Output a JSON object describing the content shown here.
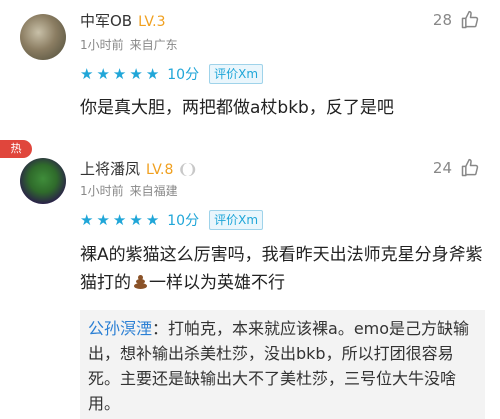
{
  "comments": [
    {
      "username": "中军OB",
      "level": "LV.3",
      "time": "1小时前",
      "location": "来自广东",
      "likes": "28",
      "stars": 5,
      "score": "10分",
      "eval_tag": "评价Xm",
      "text": "你是真大胆，两把都做a杖bkb，反了是吧"
    },
    {
      "hot_badge": "热",
      "username": "上将潘凤",
      "level": "LV.8",
      "time": "1小时前",
      "location": "来自福建",
      "likes": "24",
      "stars": 5,
      "score": "10分",
      "eval_tag": "评价Xm",
      "text_before_emoji": "裸A的紫猫这么厉害吗，我看昨天出法师克星分身斧紫猫打的",
      "emoji": "poop",
      "text_after_emoji": "一样以为英雄不行",
      "reply": {
        "name": "公孙溟湮",
        "text": "：打帕克，本来就应该裸a。emo是己方缺输出，想补输出杀美杜莎，没出bkb，所以打团很容易死。主要还是缺输出大不了美杜莎，三号位大牛没啥用。"
      }
    }
  ],
  "top_hot_badge": "热"
}
